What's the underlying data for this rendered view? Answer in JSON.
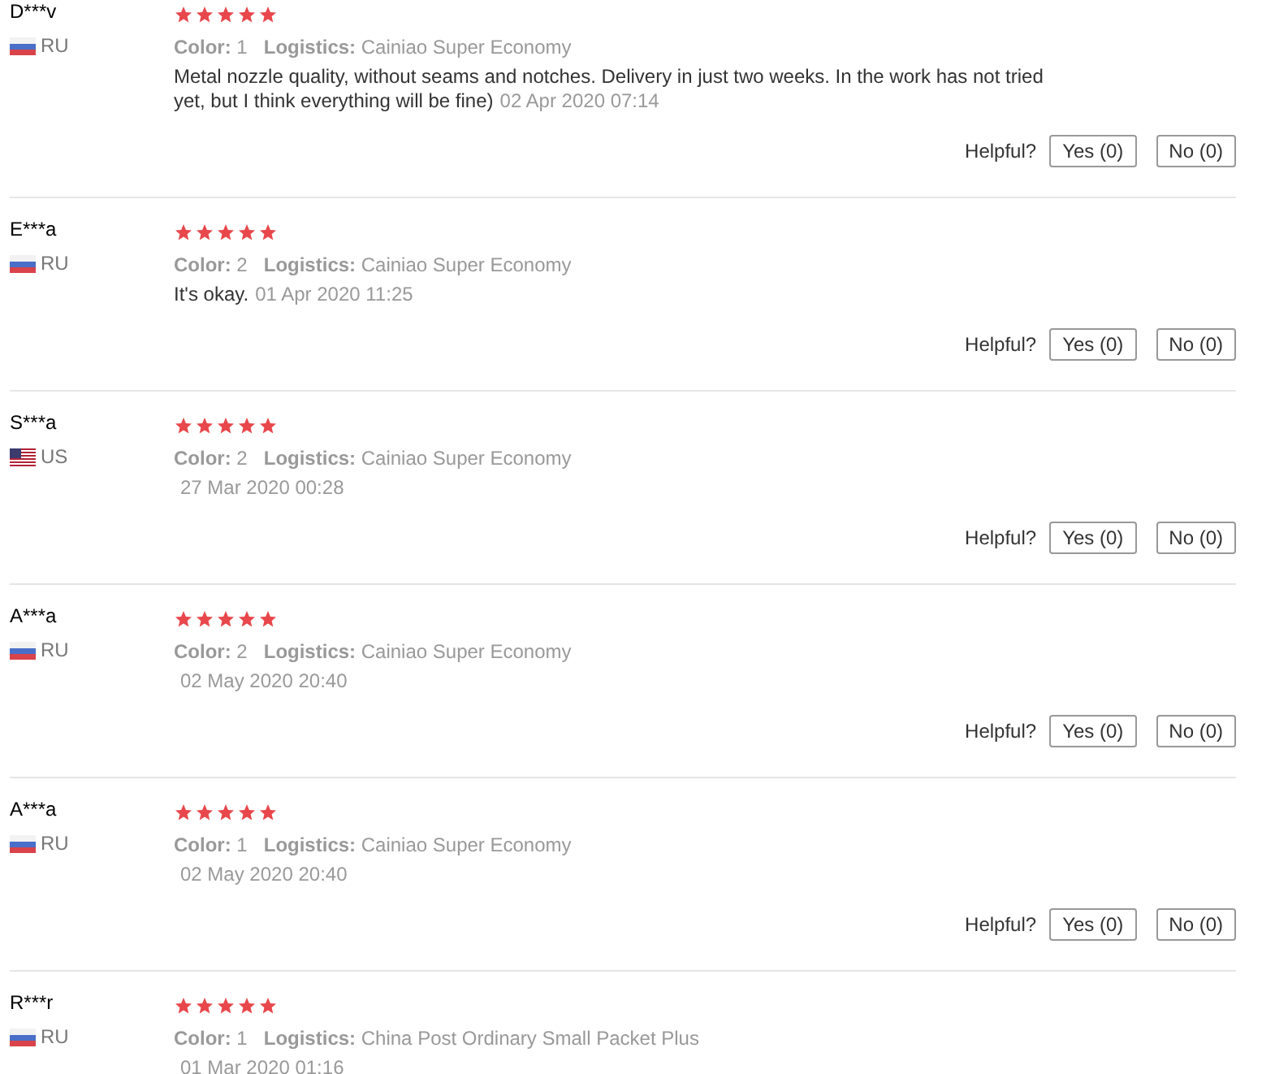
{
  "reviews": [
    {
      "name": "D***v",
      "country": "RU",
      "stars": 5,
      "color_label": "Color:",
      "color_value": "1",
      "logistics_label": "Logistics:",
      "logistics": "Cainiao Super Economy",
      "text": "Metal nozzle quality, without seams and notches. Delivery in just two weeks. In the work has not tried yet, but I think everything will be fine)",
      "date": "02 Apr 2020 07:14",
      "helpful_label": "Helpful?",
      "yes": "Yes (0)",
      "no": "No (0)"
    },
    {
      "name": "E***a",
      "country": "RU",
      "stars": 5,
      "color_label": "Color:",
      "color_value": "2",
      "logistics_label": "Logistics:",
      "logistics": "Cainiao Super Economy",
      "text": "It's okay.",
      "date": "01 Apr 2020 11:25",
      "helpful_label": "Helpful?",
      "yes": "Yes (0)",
      "no": "No (0)"
    },
    {
      "name": "S***a",
      "country": "US",
      "stars": 5,
      "color_label": "Color:",
      "color_value": "2",
      "logistics_label": "Logistics:",
      "logistics": "Cainiao Super Economy",
      "date": "27 Mar 2020 00:28",
      "helpful_label": "Helpful?",
      "yes": "Yes (0)",
      "no": "No (0)"
    },
    {
      "name": "A***a",
      "country": "RU",
      "stars": 5,
      "color_label": "Color:",
      "color_value": "2",
      "logistics_label": "Logistics:",
      "logistics": "Cainiao Super Economy",
      "date": "02 May 2020 20:40",
      "helpful_label": "Helpful?",
      "yes": "Yes (0)",
      "no": "No (0)"
    },
    {
      "name": "A***a",
      "country": "RU",
      "stars": 5,
      "color_label": "Color:",
      "color_value": "1",
      "logistics_label": "Logistics:",
      "logistics": "Cainiao Super Economy",
      "date": "02 May 2020 20:40",
      "helpful_label": "Helpful?",
      "yes": "Yes (0)",
      "no": "No (0)"
    },
    {
      "name": "R***r",
      "country": "RU",
      "stars": 5,
      "color_label": "Color:",
      "color_value": "1",
      "logistics_label": "Logistics:",
      "logistics": "China Post Ordinary Small Packet Plus",
      "date": "01 Mar 2020 01:16"
    }
  ]
}
